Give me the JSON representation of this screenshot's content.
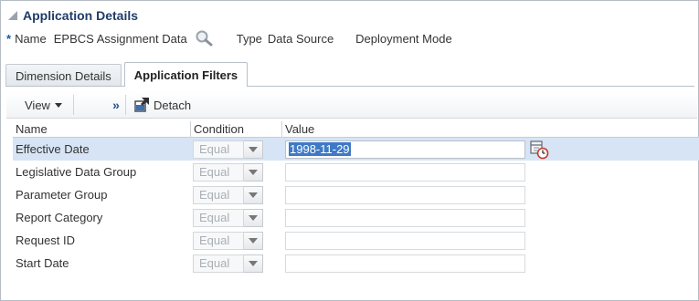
{
  "header": {
    "title": "Application Details"
  },
  "info": {
    "required_mark": "*",
    "name_label": "Name",
    "name_value": "EPBCS Assignment Data",
    "type_label": "Type",
    "type_value": "Data Source",
    "deployment_label": "Deployment Mode"
  },
  "tabs": [
    {
      "label": "Dimension Details",
      "active": false
    },
    {
      "label": "Application Filters",
      "active": true
    }
  ],
  "toolbar": {
    "view_label": "View",
    "overflow_label": "»",
    "detach_label": "Detach"
  },
  "table": {
    "columns": [
      "Name",
      "Condition",
      "Value"
    ],
    "rows": [
      {
        "name": "Effective Date",
        "condition": "Equal",
        "value": "1998-11-29",
        "selected": true
      },
      {
        "name": "Legislative Data Group",
        "condition": "Equal",
        "value": "",
        "selected": false
      },
      {
        "name": "Parameter Group",
        "condition": "Equal",
        "value": "",
        "selected": false
      },
      {
        "name": "Report Category",
        "condition": "Equal",
        "value": "",
        "selected": false
      },
      {
        "name": "Request ID",
        "condition": "Equal",
        "value": "",
        "selected": false
      },
      {
        "name": "Start Date",
        "condition": "Equal",
        "value": "",
        "selected": false
      }
    ]
  },
  "icons": {
    "collapse": "collapse-triangle-icon",
    "search": "magnifier-icon",
    "detach": "detach-icon",
    "date_picker": "calendar-icon"
  },
  "colors": {
    "title": "#1f3c67",
    "selected_row": "#d6e4f5",
    "selection_highlight": "#3f79c6"
  }
}
